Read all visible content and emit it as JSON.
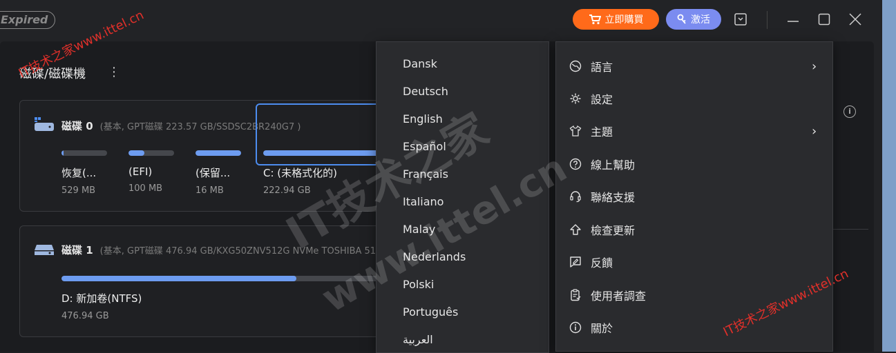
{
  "titlebar": {
    "expired_label": "Expired",
    "buy_label": "立即購買",
    "activate_label": "激活"
  },
  "main": {
    "section_title": "磁碟/磁碟機",
    "disk0": {
      "name": "磁碟 0",
      "meta": "(基本, GPT磁碟 223.57 GB/SSDSC2BR240G7 )",
      "partitions": [
        {
          "name": "恢复(...",
          "size": "529 MB",
          "fill": 0.05
        },
        {
          "name": "(EFI)",
          "size": "100 MB",
          "fill": 0.35
        },
        {
          "name": "(保留...",
          "size": "16 MB",
          "fill": 1.0
        },
        {
          "name": "C: (未格式化的)",
          "size": "222.94 GB",
          "fill": 1.0
        }
      ]
    },
    "disk1": {
      "name": "磁碟 1",
      "meta": "(基本, GPT磁碟 476.94 GB/KXG50ZNV512G NVMe TOSHIBA 51",
      "partition": {
        "name": "D: 新加卷(NTFS)",
        "size": "476.94 GB",
        "fill": 0.74
      }
    }
  },
  "language_menu": {
    "items": [
      "Dansk",
      "Deutsch",
      "English",
      "Español",
      "Français",
      "Italiano",
      "Malay",
      "Nederlands",
      "Polski",
      "Português",
      "العربية"
    ]
  },
  "main_menu": {
    "items": [
      {
        "label": "語言",
        "icon": "globe-icon",
        "submenu": true
      },
      {
        "label": "設定",
        "icon": "gear-icon",
        "submenu": false
      },
      {
        "label": "主題",
        "icon": "shirt-icon",
        "submenu": true
      },
      {
        "label": "線上幫助",
        "icon": "help-icon",
        "submenu": false
      },
      {
        "label": "聯絡支援",
        "icon": "headset-icon",
        "submenu": false
      },
      {
        "label": "檢查更新",
        "icon": "upload-arrow-icon",
        "submenu": false
      },
      {
        "label": "反饋",
        "icon": "feedback-icon",
        "submenu": false
      },
      {
        "label": "使用者調查",
        "icon": "clipboard-icon",
        "submenu": false
      },
      {
        "label": "關於",
        "icon": "info-icon",
        "submenu": false
      }
    ]
  },
  "watermarks": {
    "small": "IT技术之家www.ittel.cn",
    "big_top": "IT技术之家",
    "big_bottom": "www.ittel.cn"
  },
  "colors": {
    "accent_blue": "#4d8df0",
    "bar_fill": "#6d9cf0",
    "buy_orange": "#ff6a1a",
    "activate_purple": "#7b8cf0",
    "watermark_red": "#e0302a"
  }
}
